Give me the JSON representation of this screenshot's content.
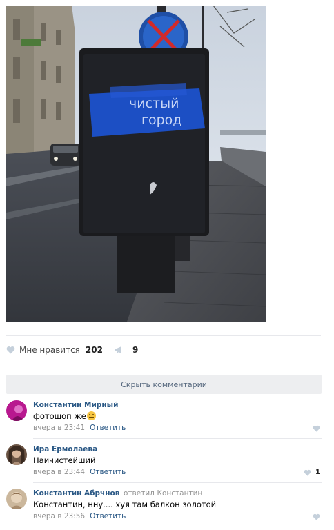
{
  "photo": {
    "poster_text_line1": "чистый",
    "poster_text_line2": "город"
  },
  "actions": {
    "like_label": "Мне нравится",
    "like_count": "202",
    "share_count": "9",
    "like_icon": "heart-icon",
    "share_icon": "megaphone-icon"
  },
  "hide_comments_label": "Скрыть комментарии",
  "comments": [
    {
      "author": "Константин Мирный",
      "text": "фотошоп же",
      "has_emoji": true,
      "time": "вчера в 23:41",
      "reply_label": "Ответить",
      "likes": ""
    },
    {
      "author": "Ира Ермолаева",
      "text": "Наичистейший",
      "time": "вчера в 23:44",
      "reply_label": "Ответить",
      "likes": "1"
    },
    {
      "author": "Константин Абрчнов",
      "replied_label": "ответил",
      "replied_to": "Константин",
      "text": "Константин, нну.... хуя там балкон золотой",
      "time": "вчера в 23:56",
      "reply_label": "Ответить",
      "likes": ""
    }
  ],
  "colors": {
    "link": "#2a5885",
    "meta": "#939393",
    "divider": "#e7e8ec",
    "button_bg": "#edeef0",
    "icon_gray": "#c5d0db"
  }
}
